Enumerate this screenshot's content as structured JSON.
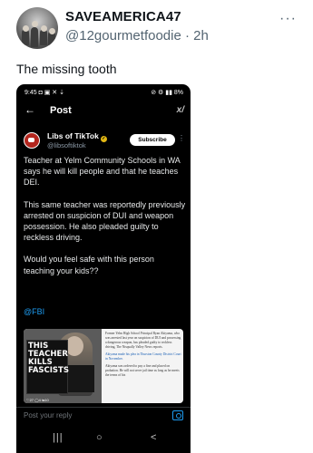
{
  "tweet": {
    "display_name": "SAVEAMERICA47",
    "handle": "@12gourmetfoodie",
    "separator": "·",
    "time": "2h",
    "more": "···",
    "text": "The missing tooth"
  },
  "phone": {
    "status": {
      "time": "9:45",
      "left_icons": "◘ ▣ ✕ ⇣",
      "right_icons": "⊘ ⚙ ▮▮",
      "battery": "8%"
    },
    "nav": {
      "back": "←",
      "title": "Post",
      "grok": "x/"
    },
    "post": {
      "author_name": "Libs of TikTok",
      "author_handle": "@libsoftiktok",
      "subscribe_label": "Subscribe",
      "more": "⋮",
      "paragraphs": [
        "Teacher at Yelm Community Schools in WA says he will kill people and that he teaches DEI.",
        "This same teacher was reportedly previously arrested on suspicion of DUI and weapon possession. He also pleaded guilty to reckless driving.",
        "Would you feel safe with this person teaching your kids??"
      ],
      "mention": "@FBI"
    },
    "media": {
      "sign_lines": [
        "THIS",
        "TEACHER",
        "KILLS",
        "FASCISTS"
      ],
      "photo_stats": "♡27 ◯4 ⇆10",
      "article_paragraphs": [
        "Former Yelm High School Principal Ryan Akiyama, who was arrested last year on suspicion of DUI and possessing a dangerous weapon, has pleaded guilty to reckless driving, The Nisqually Valley News reports.",
        "Akiyama made his plea in Thurston County District Court in November.",
        "Akiyama was ordered to pay a fine and placed on probation. He will not serve jail time as long as he meets the terms of his"
      ]
    },
    "reply": {
      "placeholder": "Post your reply"
    },
    "system_nav": {
      "recents": "|||",
      "home": "○",
      "back": "<"
    }
  }
}
